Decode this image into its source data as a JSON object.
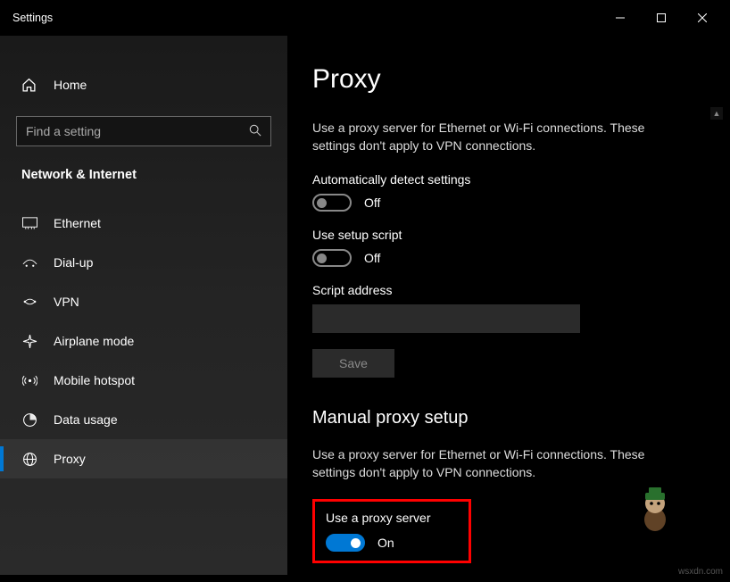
{
  "window": {
    "title": "Settings"
  },
  "sidebar": {
    "home_label": "Home",
    "search_placeholder": "Find a setting",
    "category": "Network & Internet",
    "items": [
      {
        "label": "Ethernet"
      },
      {
        "label": "Dial-up"
      },
      {
        "label": "VPN"
      },
      {
        "label": "Airplane mode"
      },
      {
        "label": "Mobile hotspot"
      },
      {
        "label": "Data usage"
      },
      {
        "label": "Proxy"
      }
    ]
  },
  "main": {
    "page_title": "Proxy",
    "auto_desc": "Use a proxy server for Ethernet or Wi-Fi connections. These settings don't apply to VPN connections.",
    "auto_detect_label": "Automatically detect settings",
    "auto_detect_state": "Off",
    "setup_script_label": "Use setup script",
    "setup_script_state": "Off",
    "script_address_label": "Script address",
    "script_address_value": "",
    "save_label": "Save",
    "manual_section_title": "Manual proxy setup",
    "manual_desc": "Use a proxy server for Ethernet or Wi-Fi connections. These settings don't apply to VPN connections.",
    "use_proxy_label": "Use a proxy server",
    "use_proxy_state": "On"
  },
  "watermark": "wsxdn.com"
}
